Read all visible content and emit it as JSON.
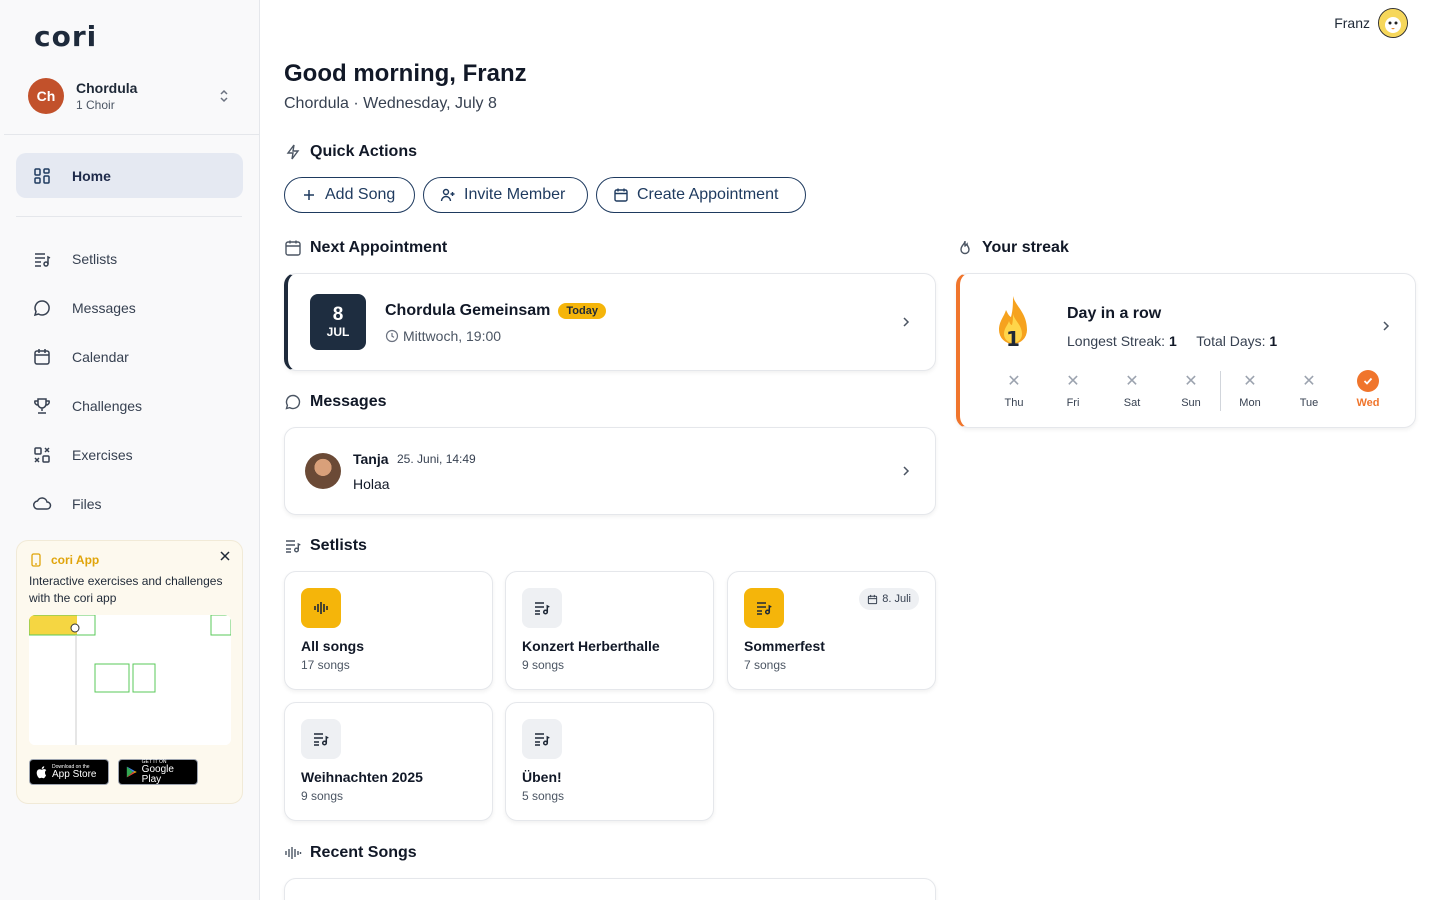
{
  "app": {
    "logo": "cori"
  },
  "choir": {
    "initials": "Ch",
    "name": "Chordula",
    "subtitle": "1 Choir"
  },
  "nav": {
    "home": "Home",
    "items": [
      {
        "label": "Setlists",
        "icon": "setlist-icon"
      },
      {
        "label": "Messages",
        "icon": "message-icon"
      },
      {
        "label": "Calendar",
        "icon": "calendar-icon"
      },
      {
        "label": "Challenges",
        "icon": "trophy-icon"
      },
      {
        "label": "Exercises",
        "icon": "exercise-icon"
      },
      {
        "label": "Files",
        "icon": "cloud-icon"
      }
    ]
  },
  "promo": {
    "title": "cori App",
    "description": "Interactive exercises and challenges with the cori app",
    "appstore_small": "Download on the",
    "appstore_big": "App Store",
    "googleplay_small": "GET IT ON",
    "googleplay_big": "Google Play"
  },
  "user": {
    "name": "Franz"
  },
  "header": {
    "greeting": "Good morning, Franz",
    "subtitle": "Chordula · Wednesday, July 8"
  },
  "quick_actions": {
    "title": "Quick Actions",
    "buttons": [
      "Add Song",
      "Invite Member",
      "Create Appointment"
    ]
  },
  "next_appointment": {
    "title": "Next Appointment",
    "day": "8",
    "month": "JUL",
    "name": "Chordula Gemeinsam",
    "badge": "Today",
    "time": "Mittwoch, 19:00"
  },
  "messages": {
    "title": "Messages",
    "author": "Tanja",
    "date": "25. Juni, 14:49",
    "text": "Holaa"
  },
  "setlists": {
    "title": "Setlists",
    "items": [
      {
        "name": "All songs",
        "count": "17 songs",
        "color": "yellow"
      },
      {
        "name": "Konzert Herberthalle",
        "count": "9 songs",
        "color": "gray"
      },
      {
        "name": "Sommerfest",
        "count": "7 songs",
        "color": "yellow",
        "date": "8. Juli"
      },
      {
        "name": "Weihnachten 2025",
        "count": "9 songs",
        "color": "gray"
      },
      {
        "name": "Üben!",
        "count": "5 songs",
        "color": "gray"
      }
    ]
  },
  "recent_songs": {
    "title": "Recent Songs"
  },
  "streak": {
    "title": "Your streak",
    "count": "1",
    "heading": "Day in a row",
    "longest_label": "Longest Streak:",
    "longest_value": "1",
    "total_label": "Total Days:",
    "total_value": "1",
    "days": [
      {
        "label": "Thu",
        "done": false
      },
      {
        "label": "Fri",
        "done": false
      },
      {
        "label": "Sat",
        "done": false
      },
      {
        "label": "Sun",
        "done": false
      },
      {
        "label": "Mon",
        "done": false
      },
      {
        "label": "Tue",
        "done": false
      },
      {
        "label": "Wed",
        "done": true
      }
    ]
  },
  "colors": {
    "accent": "#1e3a5f",
    "yellow": "#f5b50a",
    "orange": "#f0752c",
    "choir_avatar": "#c2512b"
  }
}
